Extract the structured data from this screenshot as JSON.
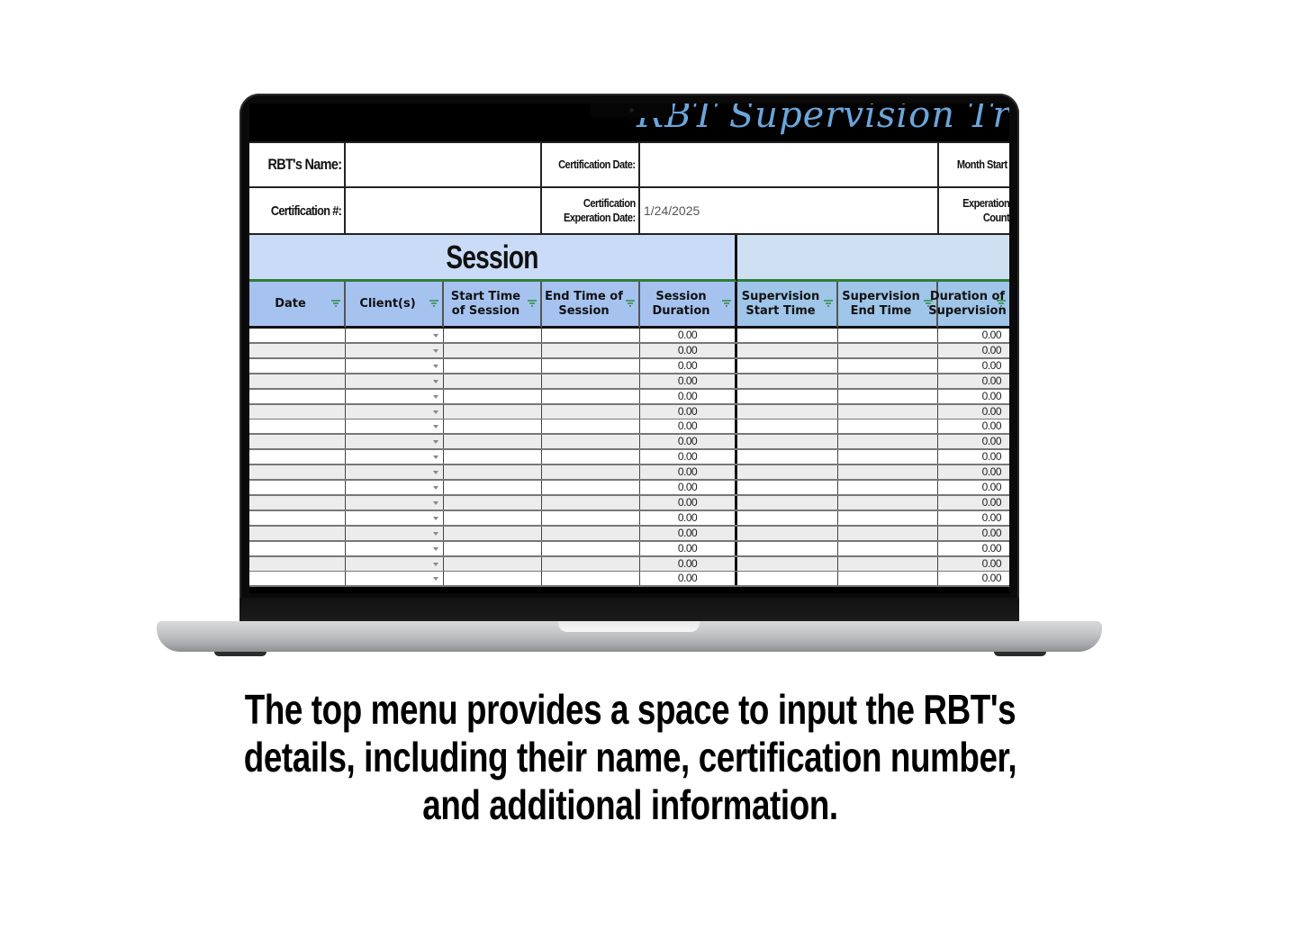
{
  "sheet": {
    "title": "RBT Supervision Track",
    "info": {
      "rbt_name_label": "RBT's Name:",
      "rbt_name_value": "",
      "cert_number_label": "Certification #:",
      "cert_number_value": "",
      "cert_date_label": "Certification Date:",
      "cert_date_value": "",
      "cert_exp_label_line1": "Certification",
      "cert_exp_label_line2": "Experation Date:",
      "cert_exp_value": "1/24/2025",
      "month_start_label": "Month Start",
      "exp_count_label_line1": "Experation",
      "exp_count_label_line2": "Count"
    },
    "sections": {
      "session": "Session",
      "supervision": ""
    },
    "columns": [
      {
        "line1": "Date",
        "line2": ""
      },
      {
        "line1": "Client(s)",
        "line2": ""
      },
      {
        "line1": "Start Time",
        "line2": "of Session"
      },
      {
        "line1": "End Time of",
        "line2": "Session"
      },
      {
        "line1": "Session",
        "line2": "Duration"
      },
      {
        "line1": "Supervision",
        "line2": "Start Time"
      },
      {
        "line1": "Supervision",
        "line2": "End Time"
      },
      {
        "line1": "Duration of",
        "line2": "Supervision"
      }
    ],
    "rows": [
      {
        "session_duration": "0.00",
        "supervision_duration": "0.00"
      },
      {
        "session_duration": "0.00",
        "supervision_duration": "0.00"
      },
      {
        "session_duration": "0.00",
        "supervision_duration": "0.00"
      },
      {
        "session_duration": "0.00",
        "supervision_duration": "0.00"
      },
      {
        "session_duration": "0.00",
        "supervision_duration": "0.00"
      },
      {
        "session_duration": "0.00",
        "supervision_duration": "0.00"
      },
      {
        "session_duration": "0.00",
        "supervision_duration": "0.00"
      },
      {
        "session_duration": "0.00",
        "supervision_duration": "0.00"
      },
      {
        "session_duration": "0.00",
        "supervision_duration": "0.00"
      },
      {
        "session_duration": "0.00",
        "supervision_duration": "0.00"
      },
      {
        "session_duration": "0.00",
        "supervision_duration": "0.00"
      },
      {
        "session_duration": "0.00",
        "supervision_duration": "0.00"
      },
      {
        "session_duration": "0.00",
        "supervision_duration": "0.00"
      },
      {
        "session_duration": "0.00",
        "supervision_duration": "0.00"
      },
      {
        "session_duration": "0.00",
        "supervision_duration": "0.00"
      },
      {
        "session_duration": "0.00",
        "supervision_duration": "0.00"
      },
      {
        "session_duration": "0.00",
        "supervision_duration": "0.00"
      }
    ]
  },
  "colors": {
    "title": "#6aa6dc",
    "session_band": "#c9dbf6",
    "header_blue": "#a6c3f0",
    "header_supervision": "#9fc5e8",
    "filter_icon": "#4a9a6b",
    "alt_row": "#ececec"
  },
  "caption": "The top menu provides a space to input the RBT's details, including their name, certification number, and additional information."
}
